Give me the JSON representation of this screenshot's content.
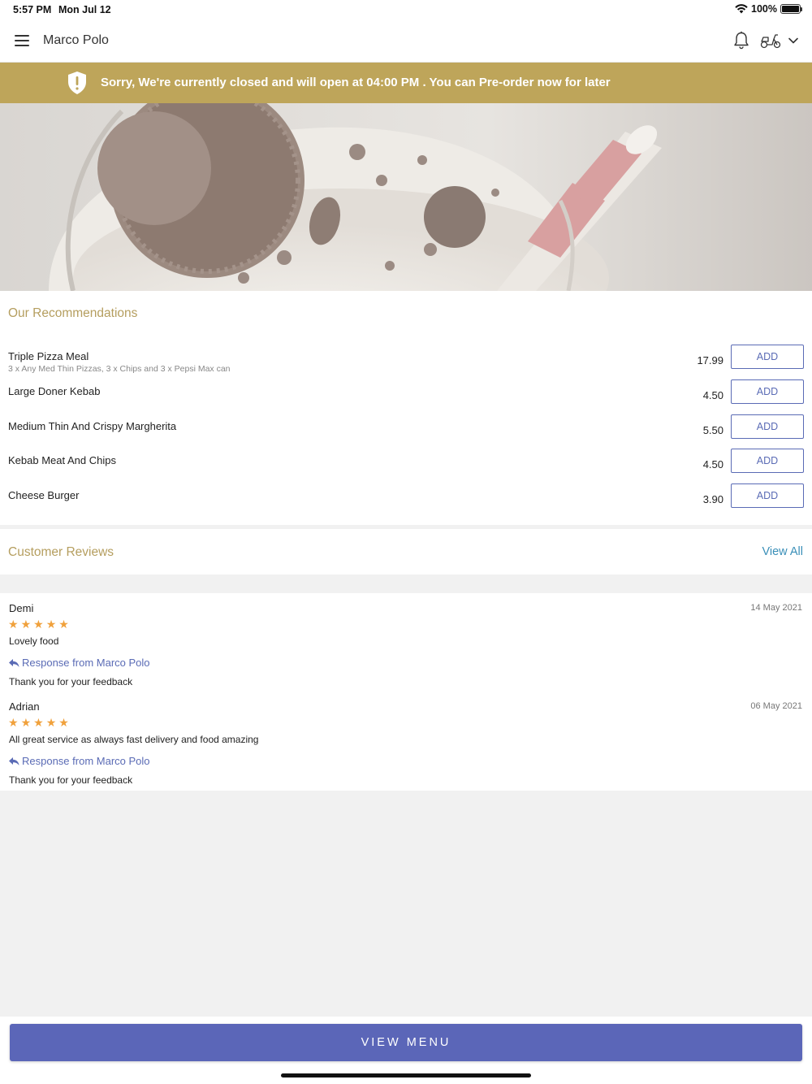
{
  "status_bar": {
    "time": "5:57 PM",
    "date": "Mon Jul 12",
    "battery": "100%"
  },
  "header": {
    "title": "Marco Polo",
    "icons": [
      "menu-icon",
      "bell-icon",
      "scooter-icon",
      "chevron-down-icon"
    ]
  },
  "notice": {
    "text": "Sorry, We're currently closed and will open at 04:00 PM . You can Pre-order now for later",
    "background": "#bea55a"
  },
  "recommendations": {
    "title": "Our Recommendations",
    "add_label": "ADD",
    "items": [
      {
        "name": "Triple Pizza Meal",
        "description": "3 x Any Med Thin Pizzas, 3 x Chips and 3 x Pepsi Max can",
        "price": "17.99"
      },
      {
        "name": "Large Doner Kebab",
        "description": "",
        "price": "4.50"
      },
      {
        "name": "Medium Thin And Crispy Margherita",
        "description": "",
        "price": "5.50"
      },
      {
        "name": "Kebab Meat And Chips",
        "description": "",
        "price": "4.50"
      },
      {
        "name": "Cheese Burger",
        "description": "",
        "price": "3.90"
      }
    ]
  },
  "reviews": {
    "title": "Customer Reviews",
    "view_all": "View All",
    "items": [
      {
        "name": "Demi",
        "date": "14 May 2021",
        "rating": 5,
        "text": "Lovely food",
        "response_label": "Response from Marco Polo",
        "response": "Thank you for your feedback"
      },
      {
        "name": "Adrian",
        "date": "06 May 2021",
        "rating": 5,
        "text": "All great service as always fast delivery and food amazing",
        "response_label": "Response from Marco Polo",
        "response": "Thank you for your feedback"
      }
    ]
  },
  "footer": {
    "button": "VIEW MENU"
  },
  "colors": {
    "accent": "#5b66b8",
    "gold": "#b59e5f",
    "star": "#f0a13c",
    "link": "#3a8fb8"
  }
}
